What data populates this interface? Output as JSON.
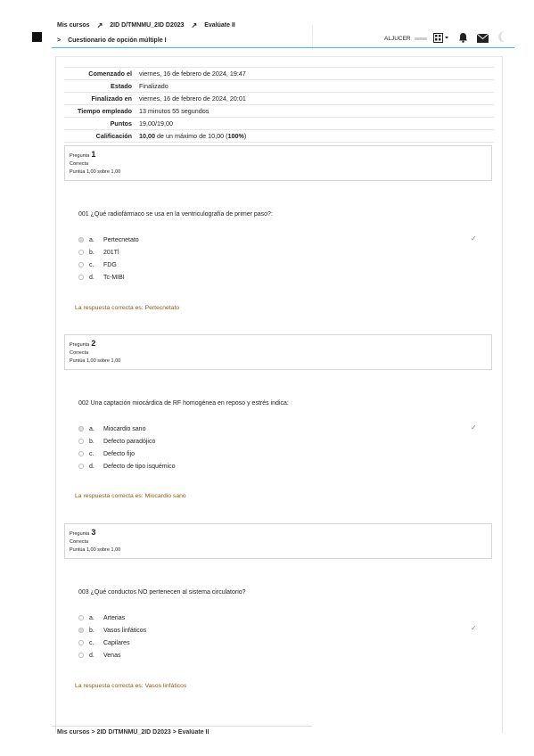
{
  "header": {
    "breadcrumb": [
      "Mis cursos",
      "2ID D/TMNMU_2ID D2023",
      "Evalúate II"
    ],
    "quiz_title": "Cuestionario de opción múltiple I",
    "user": "ALJUCER",
    "accent": "#3ac9b6"
  },
  "summary": [
    {
      "label": "Comenzado el",
      "value": "viernes, 16 de febrero de 2024, 19:47"
    },
    {
      "label": "Estado",
      "value": "Finalizado"
    },
    {
      "label": "Finalizado en",
      "value": "viernes, 16 de febrero de 2024, 20:01"
    },
    {
      "label": "Tiempo empleado",
      "value": "13 minutos 55 segundos"
    },
    {
      "label": "Puntos",
      "value": "19,00/19,00"
    },
    {
      "label": "Calificación",
      "value_bold": "10,00",
      "value_mid": " de un máximo de 10,00 (",
      "value_pct": "100%",
      "value_end": ")"
    }
  ],
  "questions": [
    {
      "prefix": "Pregunta",
      "number": "1",
      "status": "Correcta",
      "score": "Puntúa 1,00 sobre 1,00",
      "text": "001 ¿Qué radiofármaco se usa en la ventriculografía de primer paso?:",
      "options": [
        {
          "letter": "a.",
          "text": "Pertecnetato",
          "selected": true
        },
        {
          "letter": "b.",
          "text": "201Tl",
          "selected": false
        },
        {
          "letter": "c.",
          "text": "FDG",
          "selected": false
        },
        {
          "letter": "d.",
          "text": "Tc-MIBI",
          "selected": false
        }
      ],
      "feedback": "La respuesta correcta es: Pertecnetato"
    },
    {
      "prefix": "Pregunta",
      "number": "2",
      "status": "Correcta",
      "score": "Puntúa 1,00 sobre 1,00",
      "text": "002 Una captación miocárdica de RF homogénea en reposo y estrés indica:",
      "options": [
        {
          "letter": "a.",
          "text": "Miocardio sano",
          "selected": true
        },
        {
          "letter": "b.",
          "text": "Defecto paradójico",
          "selected": false
        },
        {
          "letter": "c.",
          "text": "Defecto fijo",
          "selected": false
        },
        {
          "letter": "d.",
          "text": "Defecto de tipo isquémico",
          "selected": false
        }
      ],
      "feedback": "La respuesta correcta es: Miocardio sano"
    },
    {
      "prefix": "Pregunta",
      "number": "3",
      "status": "Correcta",
      "score": "Puntúa 1,00 sobre 1,00",
      "text": "003 ¿Qué conductos NO pertenecen al sistema circulatorio?",
      "options": [
        {
          "letter": "a.",
          "text": "Arterias",
          "selected": false
        },
        {
          "letter": "b.",
          "text": "Vasos linfáticos",
          "selected": true
        },
        {
          "letter": "c.",
          "text": "Capilares",
          "selected": false
        },
        {
          "letter": "d.",
          "text": "Venas",
          "selected": false
        }
      ],
      "feedback": "La respuesta correcta es: Vasos linfáticos"
    }
  ],
  "footer": {
    "breadcrumb": "Mis cursos  >  2ID D/TMNMU_2ID D2023  >  Evalúate II"
  }
}
